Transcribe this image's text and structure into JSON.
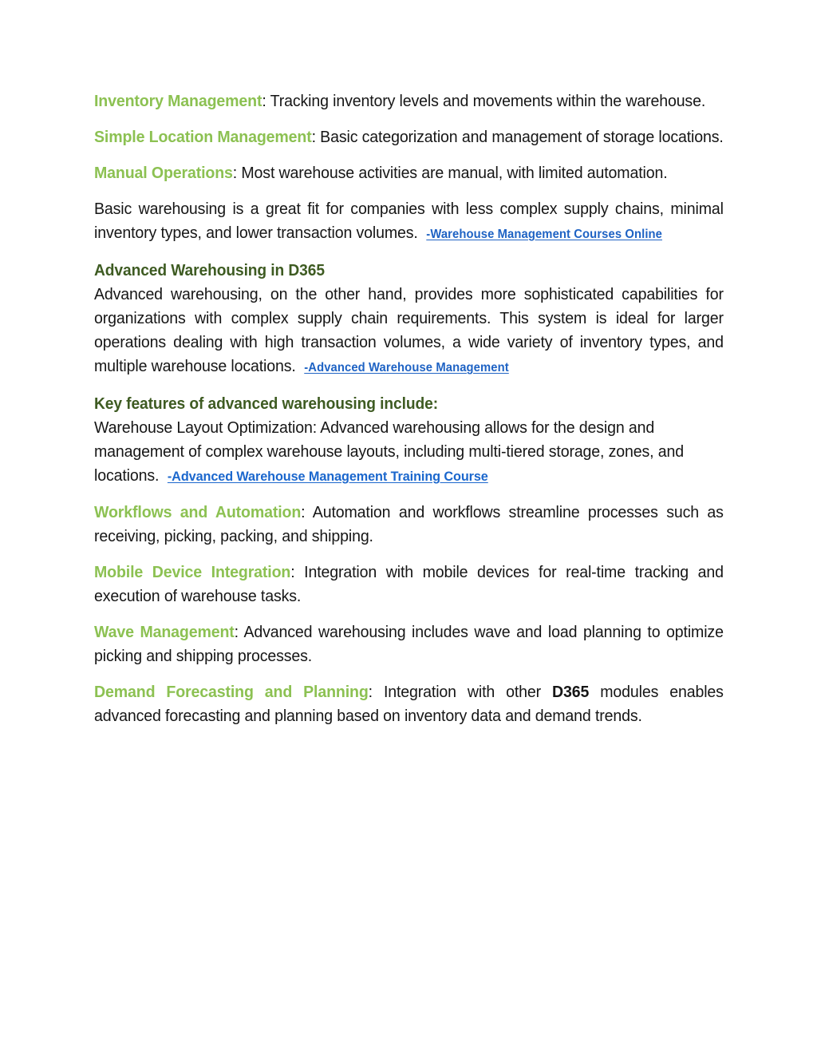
{
  "document": {
    "page_background": "#ffffff",
    "body_text_color": "#161616",
    "accent_green": "#8CC152",
    "heading_green": "#3E5B22",
    "link_blue": "#1F63C4",
    "link_blue_alt": "#1B67CD"
  },
  "paragraphs": {
    "inventory_management": {
      "lead": "Inventory Management",
      "separator": ": ",
      "body": "Tracking inventory levels and movements within the warehouse."
    },
    "simple_location_management": {
      "lead": "Simple Location Management",
      "separator": ": ",
      "body": "Basic categorization and management of storage locations."
    },
    "manual_operations": {
      "lead": "Manual Operations",
      "separator": ": ",
      "body": "Most warehouse activities are manual, with limited automation."
    },
    "basic_warehousing_fit": {
      "body": "Basic warehousing is a great fit for companies with less complex supply chains, minimal inventory types, and lower transaction volumes.",
      "link": "-Warehouse Management Courses Online"
    },
    "advanced_warehousing_intro": {
      "body": "Advanced warehousing, on the other hand, provides more sophisticated capabilities for organizations with complex supply chain requirements. This system is ideal for larger operations dealing with high transaction volumes, a wide variety of inventory types, and multiple warehouse locations.",
      "link": "-Advanced Warehouse Management"
    },
    "warehouse_layout_optimization": {
      "body": "Warehouse Layout Optimization: Advanced warehousing allows for the design and management of complex warehouse layouts, including multi-tiered storage, zones, and locations.",
      "link": "-Advanced Warehouse Management Training Course"
    },
    "workflows_and_automation": {
      "lead": "Workflows and Automation",
      "separator": ": ",
      "body": "Automation and workflows streamline processes such as receiving, picking, packing, and shipping."
    },
    "mobile_device_integration": {
      "lead": "Mobile Device Integration",
      "separator": ": ",
      "body": "Integration with mobile devices for real-time tracking and execution of warehouse tasks."
    },
    "wave_management": {
      "lead": "Wave Management",
      "separator": ": ",
      "body": "Advanced warehousing includes wave and load planning to optimize picking and shipping processes."
    },
    "demand_forecasting_and_planning": {
      "lead": "Demand Forecasting and Planning",
      "separator": ": ",
      "body_before": "Integration with other ",
      "bold_term": "D365",
      "body_after": " modules enables advanced forecasting and planning based on inventory data and demand trends."
    }
  },
  "headings": {
    "advanced_warehousing_in_d365": "Advanced Warehousing in D365",
    "key_features": "Key features of advanced warehousing include:"
  }
}
